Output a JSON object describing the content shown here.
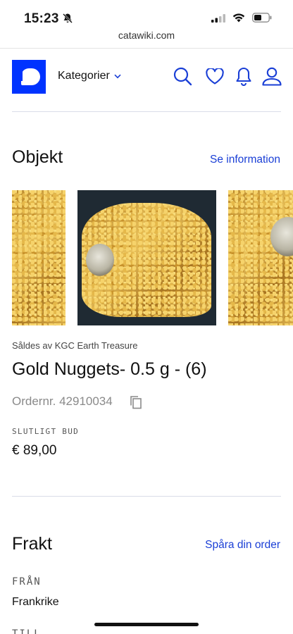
{
  "status": {
    "time": "15:23"
  },
  "browser": {
    "url": "catawiki.com"
  },
  "header": {
    "categories_label": "Kategorier",
    "icons": [
      "search-icon",
      "heart-icon",
      "bell-icon",
      "user-icon"
    ],
    "brand_color": "#0033ff",
    "accent_color": "#1a3fd6"
  },
  "object_section": {
    "title": "Objekt",
    "link": "Se information"
  },
  "product": {
    "seller": "Såldes av KGC Earth Treasure",
    "title": "Gold Nuggets- 0.5 g - (6)",
    "order_number": "Ordernr. 42910034",
    "final_bid_label": "SLUTLIGT BUD",
    "price": "€ 89,00"
  },
  "shipping_section": {
    "title": "Frakt",
    "link": "Spåra din order",
    "from_label": "FRÅN",
    "from_value": "Frankrike",
    "to_label": "TILL"
  }
}
